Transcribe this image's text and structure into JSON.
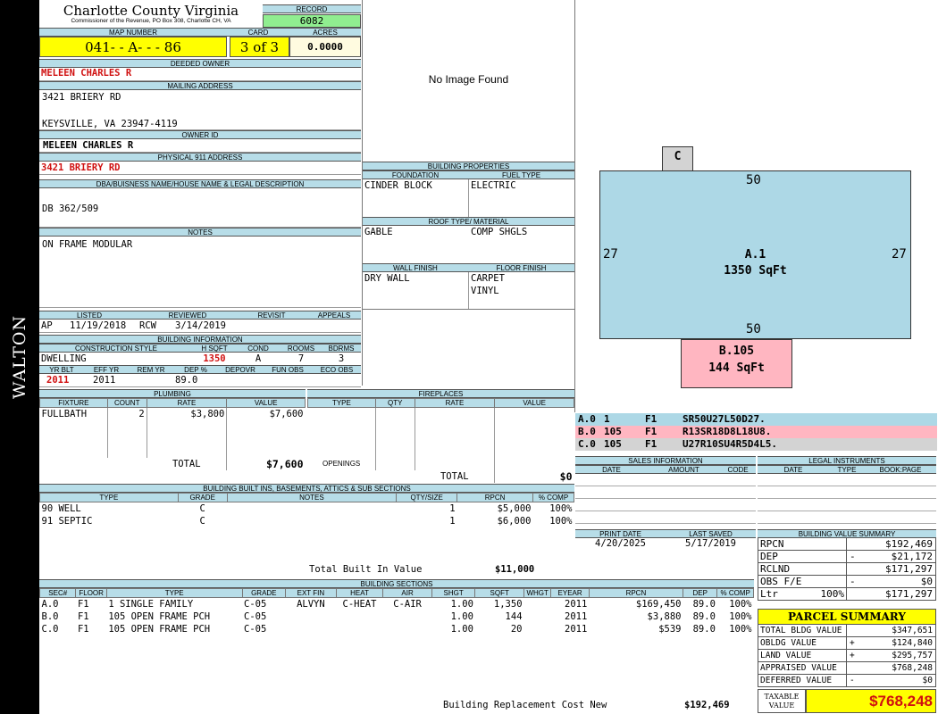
{
  "sidebar": {
    "label": "WALTON"
  },
  "header": {
    "county": "Charlotte County Virginia",
    "commissioner": "Commissioner of the Revenue, PO Box 308, Charlotte CH, VA",
    "record_label": "RECORD",
    "record": "6082",
    "map_number_label": "MAP NUMBER",
    "map_number": "041- - A- - - 86",
    "card_label": "CARD",
    "card": "3 of 3",
    "acres_label": "ACRES",
    "acres": "0.0000"
  },
  "owner": {
    "deeded_owner_label": "DEEDED OWNER",
    "deeded_owner": "MELEEN CHARLES R",
    "mailing_label": "MAILING ADDRESS",
    "mailing_line1": "3421 BRIERY RD",
    "mailing_line2": "KEYSVILLE, VA 23947-4119",
    "owner_id_label": "OWNER ID",
    "owner_id": "MELEEN CHARLES R",
    "physical_label": "PHYSICAL 911 ADDRESS",
    "physical": "3421 BRIERY RD",
    "dba_label": "DBA/BUISNESS NAME/HOUSE NAME & LEGAL DESCRIPTION",
    "dba": "DB 362/509",
    "notes_label": "NOTES",
    "notes": "ON FRAME MODULAR"
  },
  "image_box": {
    "text": "No Image Found"
  },
  "building_properties": {
    "title": "BUILDING PROPERTIES",
    "foundation_label": "FOUNDATION",
    "foundation": "CINDER BLOCK",
    "fuel_label": "FUEL TYPE",
    "fuel": "ELECTRIC",
    "roof_label": "ROOF TYPE/ MATERIAL",
    "roof_type": "GABLE",
    "roof_material": "COMP SHGLS",
    "wall_label": "WALL FINISH",
    "wall": "DRY WALL",
    "floor_label": "FLOOR FINISH",
    "floor1": "CARPET",
    "floor2": "VINYL"
  },
  "listing": {
    "listed_label": "LISTED",
    "reviewed_label": "REVIEWED",
    "revisit_label": "REVISIT",
    "appeals_label": "APPEALS",
    "listed_by": "AP",
    "listed_date": "11/19/2018",
    "reviewed_by": "RCW",
    "reviewed_date": "3/14/2019"
  },
  "building_info": {
    "title": "BUILDING INFORMATION",
    "style_label": "CONSTRUCTION STYLE",
    "hsqft_label": "H SQFT",
    "cond_label": "COND",
    "rooms_label": "ROOMS",
    "bdrms_label": "BDRMS",
    "style": "DWELLING",
    "hsqft": "1350",
    "cond": "A",
    "rooms": "7",
    "bdrms": "3",
    "yrblt_label": "YR BLT",
    "effyr_label": "EFF YR",
    "remyr_label": "REM YR",
    "dep_label": "DEP %",
    "depovr_label": "DEPOVR",
    "funobs_label": "FUN OBS",
    "ecoobs_label": "ECO OBS",
    "yrblt": "2011",
    "effyr": "2011",
    "dep": "89.0"
  },
  "plumbing": {
    "title": "PLUMBING",
    "headers": [
      "FIXTURE",
      "COUNT",
      "RATE",
      "VALUE"
    ],
    "rows": [
      [
        "FULLBATH",
        "2",
        "$3,800",
        "$7,600"
      ]
    ],
    "total_label": "TOTAL",
    "total": "$7,600"
  },
  "fireplaces": {
    "title": "FIREPLACES",
    "headers": [
      "TYPE",
      "QTY",
      "RATE",
      "VALUE"
    ],
    "openings_label": "OPENINGS",
    "total_label": "TOTAL",
    "total": "$0"
  },
  "builtins": {
    "title": "BUILDING BUILT INS, BASEMENTS, ATTICS & SUB SECTIONS",
    "headers": [
      "TYPE",
      "GRADE",
      "NOTES",
      "QTY/SIZE",
      "RPCN",
      "% COMP"
    ],
    "rows": [
      [
        "90 WELL",
        "C",
        "",
        "1",
        "$5,000",
        "100%"
      ],
      [
        "91 SEPTIC",
        "C",
        "",
        "1",
        "$6,000",
        "100%"
      ]
    ],
    "total_label": "Total Built In Value",
    "total": "$11,000"
  },
  "sections": {
    "title": "BUILDING SECTIONS",
    "headers": [
      "SEC#",
      "FLOOR",
      "TYPE",
      "GRADE",
      "EXT FIN",
      "HEAT",
      "AIR",
      "SHGT",
      "SQFT",
      "WHGT",
      "EYEAR",
      "RPCN",
      "DEP",
      "% COMP"
    ],
    "rows": [
      [
        "A.0",
        "F1",
        "1 SINGLE FAMILY",
        "C-05",
        "ALVYN",
        "C-HEAT",
        "C-AIR",
        "1.00",
        "1,350",
        "",
        "2011",
        "$169,450",
        "89.0",
        "100%"
      ],
      [
        "B.0",
        "F1",
        "105 OPEN FRAME PCH",
        "C-05",
        "",
        "",
        "",
        "1.00",
        "144",
        "",
        "2011",
        "$3,880",
        "89.0",
        "100%"
      ],
      [
        "C.0",
        "F1",
        "105 OPEN FRAME PCH",
        "C-05",
        "",
        "",
        "",
        "1.00",
        "20",
        "",
        "2011",
        "$539",
        "89.0",
        "100%"
      ]
    ],
    "brcn_label": "Building Replacement Cost New",
    "brcn": "$192,469"
  },
  "sketch": {
    "c_label": "C",
    "main_label": "A.1",
    "main_sqft": "1350 SqFt",
    "top_dim": "50",
    "bottom_dim": "50",
    "left_dim": "27",
    "right_dim": "27",
    "porch_label": "B.105",
    "porch_sqft": "144 SqFt",
    "colors": {
      "main": "#add8e6",
      "porch": "#ffb6c1",
      "c_box": "#d3d3d3"
    }
  },
  "sketch_legend": [
    {
      "sec": "A.0",
      "code": "1",
      "floor": "F1",
      "path": "SR50U27L50D27.",
      "color": "#add8e6"
    },
    {
      "sec": "B.0",
      "code": "105",
      "floor": "F1",
      "path": "R13SR18D8L18U8.",
      "color": "#ffb6c1"
    },
    {
      "sec": "C.0",
      "code": "105",
      "floor": "F1",
      "path": "U27R10SU4R5D4L5.",
      "color": "#d3d3d3"
    }
  ],
  "sales": {
    "title": "SALES INFORMATION",
    "headers": [
      "DATE",
      "AMOUNT",
      "CODE"
    ]
  },
  "legal": {
    "title": "LEGAL INSTRUMENTS",
    "headers": [
      "DATE",
      "TYPE",
      "BOOK:PAGE"
    ]
  },
  "dates": {
    "print_label": "PRINT DATE",
    "print": "4/20/2025",
    "saved_label": "LAST SAVED",
    "saved": "5/17/2019"
  },
  "value_summary": {
    "title": "BUILDING VALUE SUMMARY",
    "rows": [
      {
        "label": "RPCN",
        "sign": "",
        "value": "$192,469"
      },
      {
        "label": "DEP",
        "sign": "-",
        "value": "$21,172"
      },
      {
        "label": "RCLND",
        "sign": "",
        "value": "$171,297"
      },
      {
        "label": "OBS F/E",
        "sign": "-",
        "value": "$0"
      },
      {
        "label": "Ltr",
        "pct": "100%",
        "sign": "",
        "value": "$171,297"
      }
    ]
  },
  "parcel": {
    "title": "PARCEL SUMMARY",
    "rows": [
      {
        "label": "TOTAL BLDG VALUE",
        "sign": "",
        "value": "$347,651"
      },
      {
        "label": "OBLDG VALUE",
        "sign": "+",
        "value": "$124,840"
      },
      {
        "label": "LAND VALUE",
        "sign": "+",
        "value": "$295,757"
      },
      {
        "label": "APPRAISED VALUE",
        "sign": "",
        "value": "$768,248"
      },
      {
        "label": "DEFERRED VALUE",
        "sign": "-",
        "value": "$0"
      }
    ],
    "taxable_label1": "TAXABLE",
    "taxable_label2": "VALUE",
    "taxable": "$768,248"
  }
}
